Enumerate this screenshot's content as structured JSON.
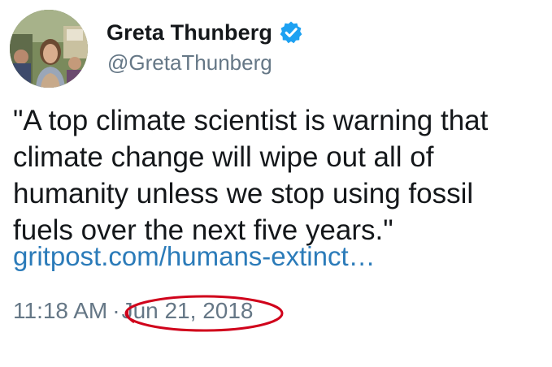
{
  "user": {
    "display_name": "Greta Thunberg",
    "handle": "@GretaThunberg",
    "verified_icon": "verified-badge-icon",
    "verified_color": "#1da1f2"
  },
  "tweet": {
    "lines": [
      "\"A top climate scientist is warning that",
      "climate change will wipe out all of",
      "humanity unless we stop using fossil",
      "fuels over the next five years.\""
    ],
    "link_text": "gritpost.com/humans-extinct…",
    "link_color": "#2b7bb9",
    "time": "11:18 AM",
    "separator": "·",
    "date": "Jun 21, 2018"
  },
  "annotation": {
    "circle_color": "#d0021b"
  }
}
